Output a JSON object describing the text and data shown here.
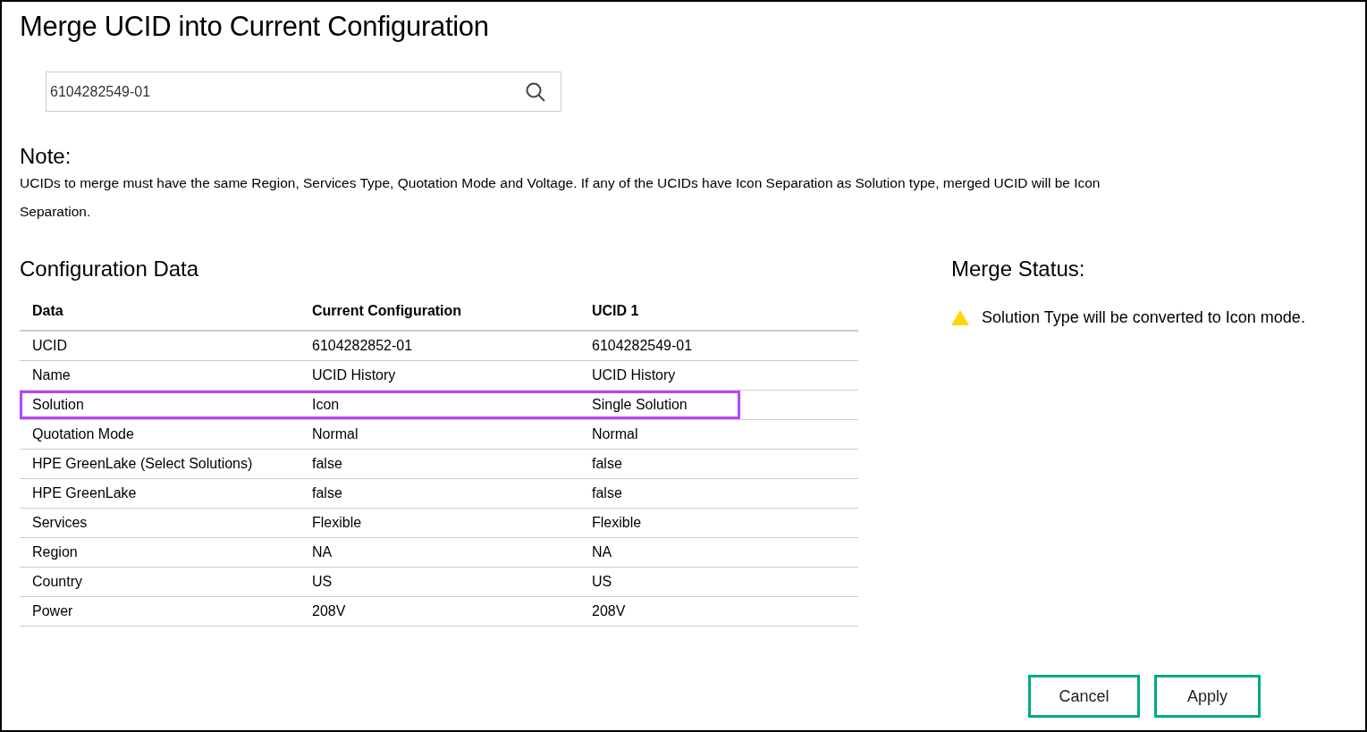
{
  "title": "Merge UCID into Current Configuration",
  "search": {
    "value": "6104282549-01"
  },
  "note": {
    "heading": "Note:",
    "text": "UCIDs to merge must have the same Region, Services Type, Quotation Mode and Voltage. If any of the UCIDs have Icon Separation as Solution type, merged UCID will be Icon Separation."
  },
  "configuration": {
    "heading": "Configuration Data",
    "columns": [
      "Data",
      "Current Configuration",
      "UCID 1"
    ],
    "rows": [
      {
        "cells": [
          "UCID",
          "6104282852-01",
          "6104282549-01"
        ],
        "highlighted": false
      },
      {
        "cells": [
          "Name",
          "UCID History",
          "UCID History"
        ],
        "highlighted": false
      },
      {
        "cells": [
          "Solution",
          "Icon",
          "Single Solution"
        ],
        "highlighted": true
      },
      {
        "cells": [
          "Quotation Mode",
          "Normal",
          "Normal"
        ],
        "highlighted": false
      },
      {
        "cells": [
          "HPE GreenLake (Select Solutions)",
          "false",
          "false"
        ],
        "highlighted": false
      },
      {
        "cells": [
          "HPE GreenLake",
          "false",
          "false"
        ],
        "highlighted": false
      },
      {
        "cells": [
          "Services",
          "Flexible",
          "Flexible"
        ],
        "highlighted": false
      },
      {
        "cells": [
          "Region",
          "NA",
          "NA"
        ],
        "highlighted": false
      },
      {
        "cells": [
          "Country",
          "US",
          "US"
        ],
        "highlighted": false
      },
      {
        "cells": [
          "Power",
          "208V",
          "208V"
        ],
        "highlighted": false
      }
    ]
  },
  "merge_status": {
    "heading": "Merge Status:",
    "messages": [
      {
        "kind": "warning",
        "text": "Solution Type will be converted to Icon mode."
      }
    ]
  },
  "buttons": [
    "Cancel",
    "Apply"
  ]
}
